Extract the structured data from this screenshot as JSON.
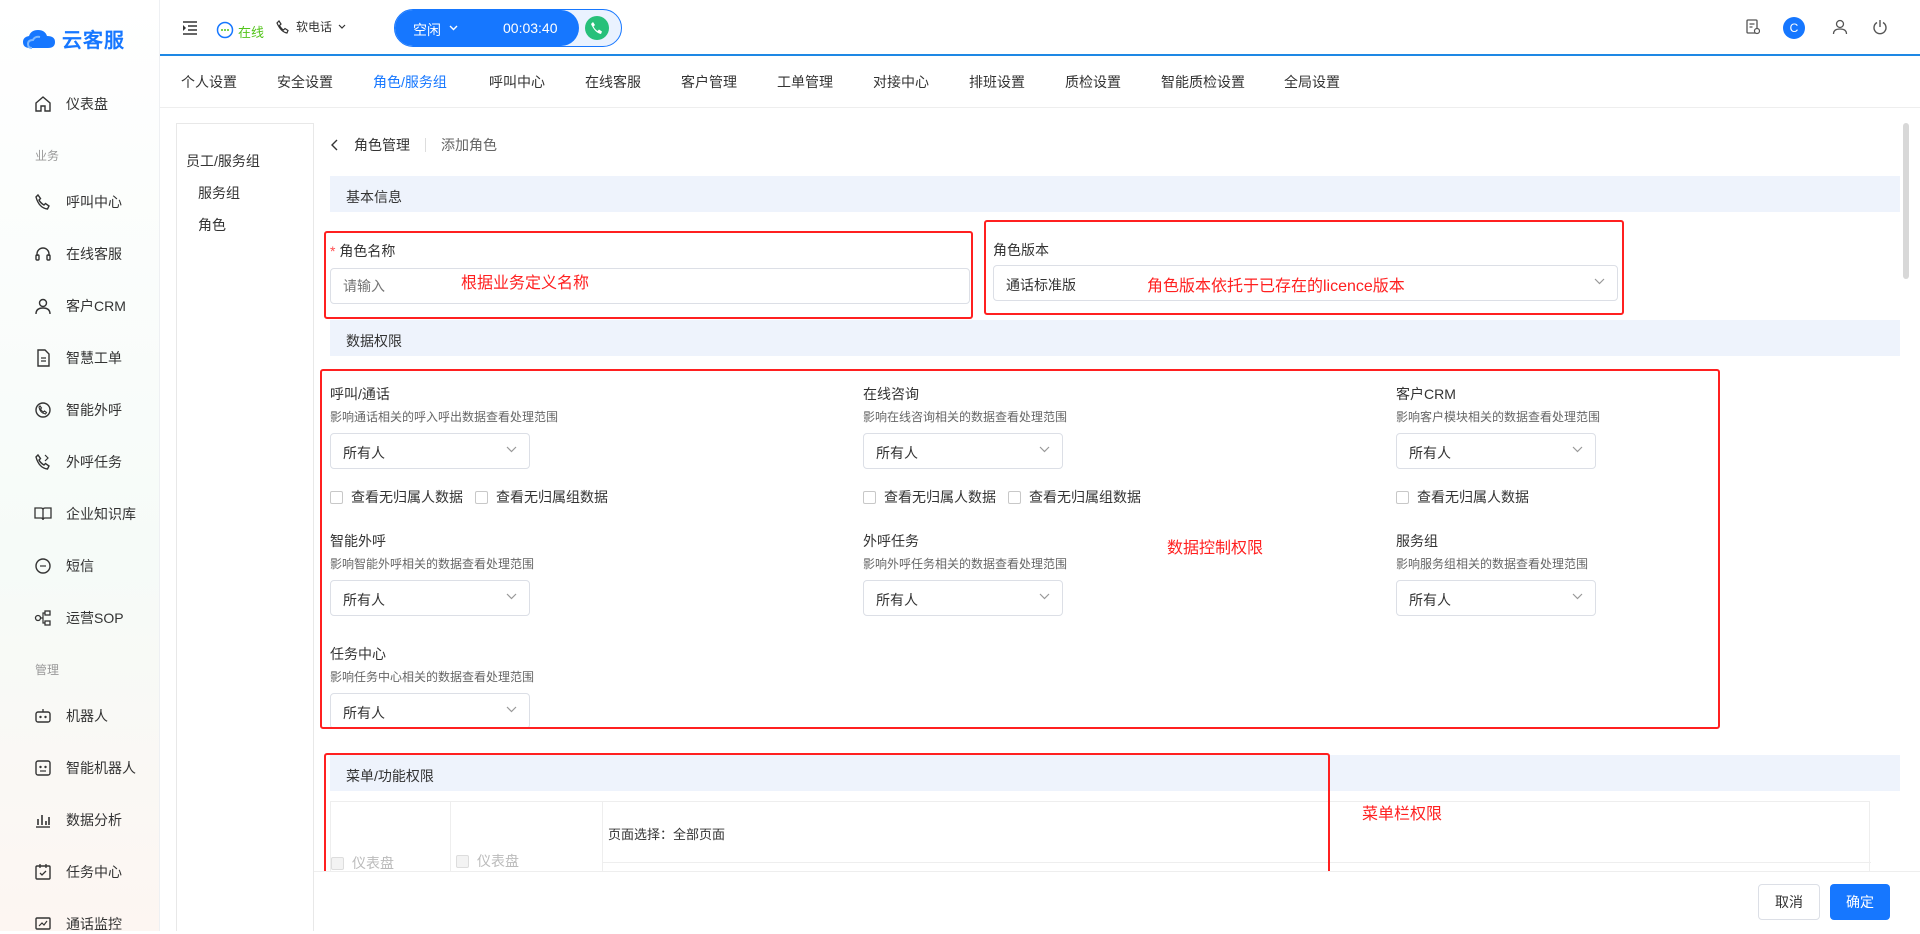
{
  "app": {
    "name": "云客服"
  },
  "sidebar": {
    "items": [
      {
        "label": "仪表盘",
        "icon": "home-icon"
      },
      {
        "label": "呼叫中心",
        "icon": "phone-icon"
      },
      {
        "label": "在线客服",
        "icon": "headset-icon"
      },
      {
        "label": "客户CRM",
        "icon": "user-icon"
      },
      {
        "label": "智慧工单",
        "icon": "document-icon"
      },
      {
        "label": "智能外呼",
        "icon": "whatsapp-phone-icon"
      },
      {
        "label": "外呼任务",
        "icon": "phone-task-icon"
      },
      {
        "label": "企业知识库",
        "icon": "book-icon"
      },
      {
        "label": "短信",
        "icon": "sms-icon"
      },
      {
        "label": "运营SOP",
        "icon": "flow-icon"
      },
      {
        "label": "机器人",
        "icon": "robot-icon"
      },
      {
        "label": "智能机器人",
        "icon": "smart-robot-icon"
      },
      {
        "label": "数据分析",
        "icon": "chart-icon"
      },
      {
        "label": "任务中心",
        "icon": "task-icon"
      },
      {
        "label": "通话监控",
        "icon": "monitor-icon"
      }
    ],
    "sections": {
      "business": "业务",
      "manage": "管理"
    }
  },
  "topbar": {
    "online_status": "在线",
    "phone_type": "软电话",
    "call_state": "空闲",
    "timer": "00:03:40",
    "avatar_letter": "C"
  },
  "tabs": [
    {
      "label": "个人设置"
    },
    {
      "label": "安全设置"
    },
    {
      "label": "角色/服务组",
      "active": true
    },
    {
      "label": "呼叫中心"
    },
    {
      "label": "在线客服"
    },
    {
      "label": "客户管理"
    },
    {
      "label": "工单管理"
    },
    {
      "label": "对接中心"
    },
    {
      "label": "排班设置"
    },
    {
      "label": "质检设置"
    },
    {
      "label": "智能质检设置"
    },
    {
      "label": "全局设置"
    }
  ],
  "leftpanel": {
    "title": "员工/服务组",
    "items": [
      "服务组",
      "角色"
    ]
  },
  "breadcrumb": {
    "parent": "角色管理",
    "current": "添加角色"
  },
  "basic": {
    "title": "基本信息",
    "role_name_label": "角色名称",
    "required_mark": "*",
    "role_name_placeholder": "请输入",
    "role_version_label": "角色版本",
    "role_version_value": "通话标准版"
  },
  "data_perm": {
    "title": "数据权限",
    "fields": [
      {
        "label": "呼叫/通话",
        "hint": "影响通话相关的呼入呼出数据查看处理范围",
        "value": "所有人",
        "checks": [
          "查看无归属人数据",
          "查看无归属组数据"
        ]
      },
      {
        "label": "在线咨询",
        "hint": "影响在线咨询相关的数据查看处理范围",
        "value": "所有人",
        "checks": [
          "查看无归属人数据",
          "查看无归属组数据"
        ]
      },
      {
        "label": "客户CRM",
        "hint": "影响客户模块相关的数据查看处理范围",
        "value": "所有人",
        "checks": [
          "查看无归属人数据"
        ]
      },
      {
        "label": "智能外呼",
        "hint": "影响智能外呼相关的数据查看处理范围",
        "value": "所有人"
      },
      {
        "label": "外呼任务",
        "hint": "影响外呼任务相关的数据查看处理范围",
        "value": "所有人"
      },
      {
        "label": "服务组",
        "hint": "影响服务组相关的数据查看处理范围",
        "value": "所有人"
      },
      {
        "label": "任务中心",
        "hint": "影响任务中心相关的数据查看处理范围",
        "value": "所有人"
      }
    ]
  },
  "menu_perm": {
    "title": "菜单/功能权限",
    "col1": "仪表盘",
    "col2": "仪表盘",
    "page_select": "页面选择：全部页面"
  },
  "annotations": {
    "name": "根据业务定义名称",
    "version": "角色版本依托于已存在的licence版本",
    "data": "数据控制权限",
    "menu": "菜单栏权限"
  },
  "footer": {
    "cancel": "取消",
    "confirm": "确定"
  },
  "colors": {
    "primary": "#1677ff",
    "annotation": "#ff2020",
    "online": "#52c41a"
  }
}
